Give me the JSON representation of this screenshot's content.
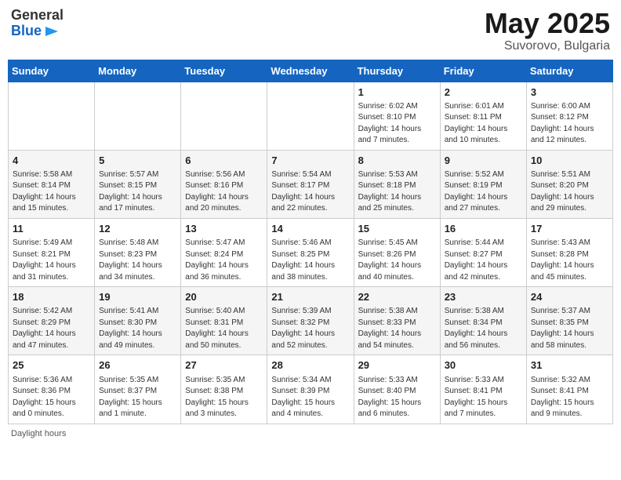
{
  "header": {
    "logo_general": "General",
    "logo_blue": "Blue",
    "title": "May 2025",
    "subtitle": "Suvorovo, Bulgaria"
  },
  "calendar": {
    "days_of_week": [
      "Sunday",
      "Monday",
      "Tuesday",
      "Wednesday",
      "Thursday",
      "Friday",
      "Saturday"
    ],
    "weeks": [
      [
        {
          "day": "",
          "info": ""
        },
        {
          "day": "",
          "info": ""
        },
        {
          "day": "",
          "info": ""
        },
        {
          "day": "",
          "info": ""
        },
        {
          "day": "1",
          "info": "Sunrise: 6:02 AM\nSunset: 8:10 PM\nDaylight: 14 hours\nand 7 minutes."
        },
        {
          "day": "2",
          "info": "Sunrise: 6:01 AM\nSunset: 8:11 PM\nDaylight: 14 hours\nand 10 minutes."
        },
        {
          "day": "3",
          "info": "Sunrise: 6:00 AM\nSunset: 8:12 PM\nDaylight: 14 hours\nand 12 minutes."
        }
      ],
      [
        {
          "day": "4",
          "info": "Sunrise: 5:58 AM\nSunset: 8:14 PM\nDaylight: 14 hours\nand 15 minutes."
        },
        {
          "day": "5",
          "info": "Sunrise: 5:57 AM\nSunset: 8:15 PM\nDaylight: 14 hours\nand 17 minutes."
        },
        {
          "day": "6",
          "info": "Sunrise: 5:56 AM\nSunset: 8:16 PM\nDaylight: 14 hours\nand 20 minutes."
        },
        {
          "day": "7",
          "info": "Sunrise: 5:54 AM\nSunset: 8:17 PM\nDaylight: 14 hours\nand 22 minutes."
        },
        {
          "day": "8",
          "info": "Sunrise: 5:53 AM\nSunset: 8:18 PM\nDaylight: 14 hours\nand 25 minutes."
        },
        {
          "day": "9",
          "info": "Sunrise: 5:52 AM\nSunset: 8:19 PM\nDaylight: 14 hours\nand 27 minutes."
        },
        {
          "day": "10",
          "info": "Sunrise: 5:51 AM\nSunset: 8:20 PM\nDaylight: 14 hours\nand 29 minutes."
        }
      ],
      [
        {
          "day": "11",
          "info": "Sunrise: 5:49 AM\nSunset: 8:21 PM\nDaylight: 14 hours\nand 31 minutes."
        },
        {
          "day": "12",
          "info": "Sunrise: 5:48 AM\nSunset: 8:23 PM\nDaylight: 14 hours\nand 34 minutes."
        },
        {
          "day": "13",
          "info": "Sunrise: 5:47 AM\nSunset: 8:24 PM\nDaylight: 14 hours\nand 36 minutes."
        },
        {
          "day": "14",
          "info": "Sunrise: 5:46 AM\nSunset: 8:25 PM\nDaylight: 14 hours\nand 38 minutes."
        },
        {
          "day": "15",
          "info": "Sunrise: 5:45 AM\nSunset: 8:26 PM\nDaylight: 14 hours\nand 40 minutes."
        },
        {
          "day": "16",
          "info": "Sunrise: 5:44 AM\nSunset: 8:27 PM\nDaylight: 14 hours\nand 42 minutes."
        },
        {
          "day": "17",
          "info": "Sunrise: 5:43 AM\nSunset: 8:28 PM\nDaylight: 14 hours\nand 45 minutes."
        }
      ],
      [
        {
          "day": "18",
          "info": "Sunrise: 5:42 AM\nSunset: 8:29 PM\nDaylight: 14 hours\nand 47 minutes."
        },
        {
          "day": "19",
          "info": "Sunrise: 5:41 AM\nSunset: 8:30 PM\nDaylight: 14 hours\nand 49 minutes."
        },
        {
          "day": "20",
          "info": "Sunrise: 5:40 AM\nSunset: 8:31 PM\nDaylight: 14 hours\nand 50 minutes."
        },
        {
          "day": "21",
          "info": "Sunrise: 5:39 AM\nSunset: 8:32 PM\nDaylight: 14 hours\nand 52 minutes."
        },
        {
          "day": "22",
          "info": "Sunrise: 5:38 AM\nSunset: 8:33 PM\nDaylight: 14 hours\nand 54 minutes."
        },
        {
          "day": "23",
          "info": "Sunrise: 5:38 AM\nSunset: 8:34 PM\nDaylight: 14 hours\nand 56 minutes."
        },
        {
          "day": "24",
          "info": "Sunrise: 5:37 AM\nSunset: 8:35 PM\nDaylight: 14 hours\nand 58 minutes."
        }
      ],
      [
        {
          "day": "25",
          "info": "Sunrise: 5:36 AM\nSunset: 8:36 PM\nDaylight: 15 hours\nand 0 minutes."
        },
        {
          "day": "26",
          "info": "Sunrise: 5:35 AM\nSunset: 8:37 PM\nDaylight: 15 hours\nand 1 minute."
        },
        {
          "day": "27",
          "info": "Sunrise: 5:35 AM\nSunset: 8:38 PM\nDaylight: 15 hours\nand 3 minutes."
        },
        {
          "day": "28",
          "info": "Sunrise: 5:34 AM\nSunset: 8:39 PM\nDaylight: 15 hours\nand 4 minutes."
        },
        {
          "day": "29",
          "info": "Sunrise: 5:33 AM\nSunset: 8:40 PM\nDaylight: 15 hours\nand 6 minutes."
        },
        {
          "day": "30",
          "info": "Sunrise: 5:33 AM\nSunset: 8:41 PM\nDaylight: 15 hours\nand 7 minutes."
        },
        {
          "day": "31",
          "info": "Sunrise: 5:32 AM\nSunset: 8:41 PM\nDaylight: 15 hours\nand 9 minutes."
        }
      ]
    ]
  },
  "footer": {
    "daylight_label": "Daylight hours"
  }
}
